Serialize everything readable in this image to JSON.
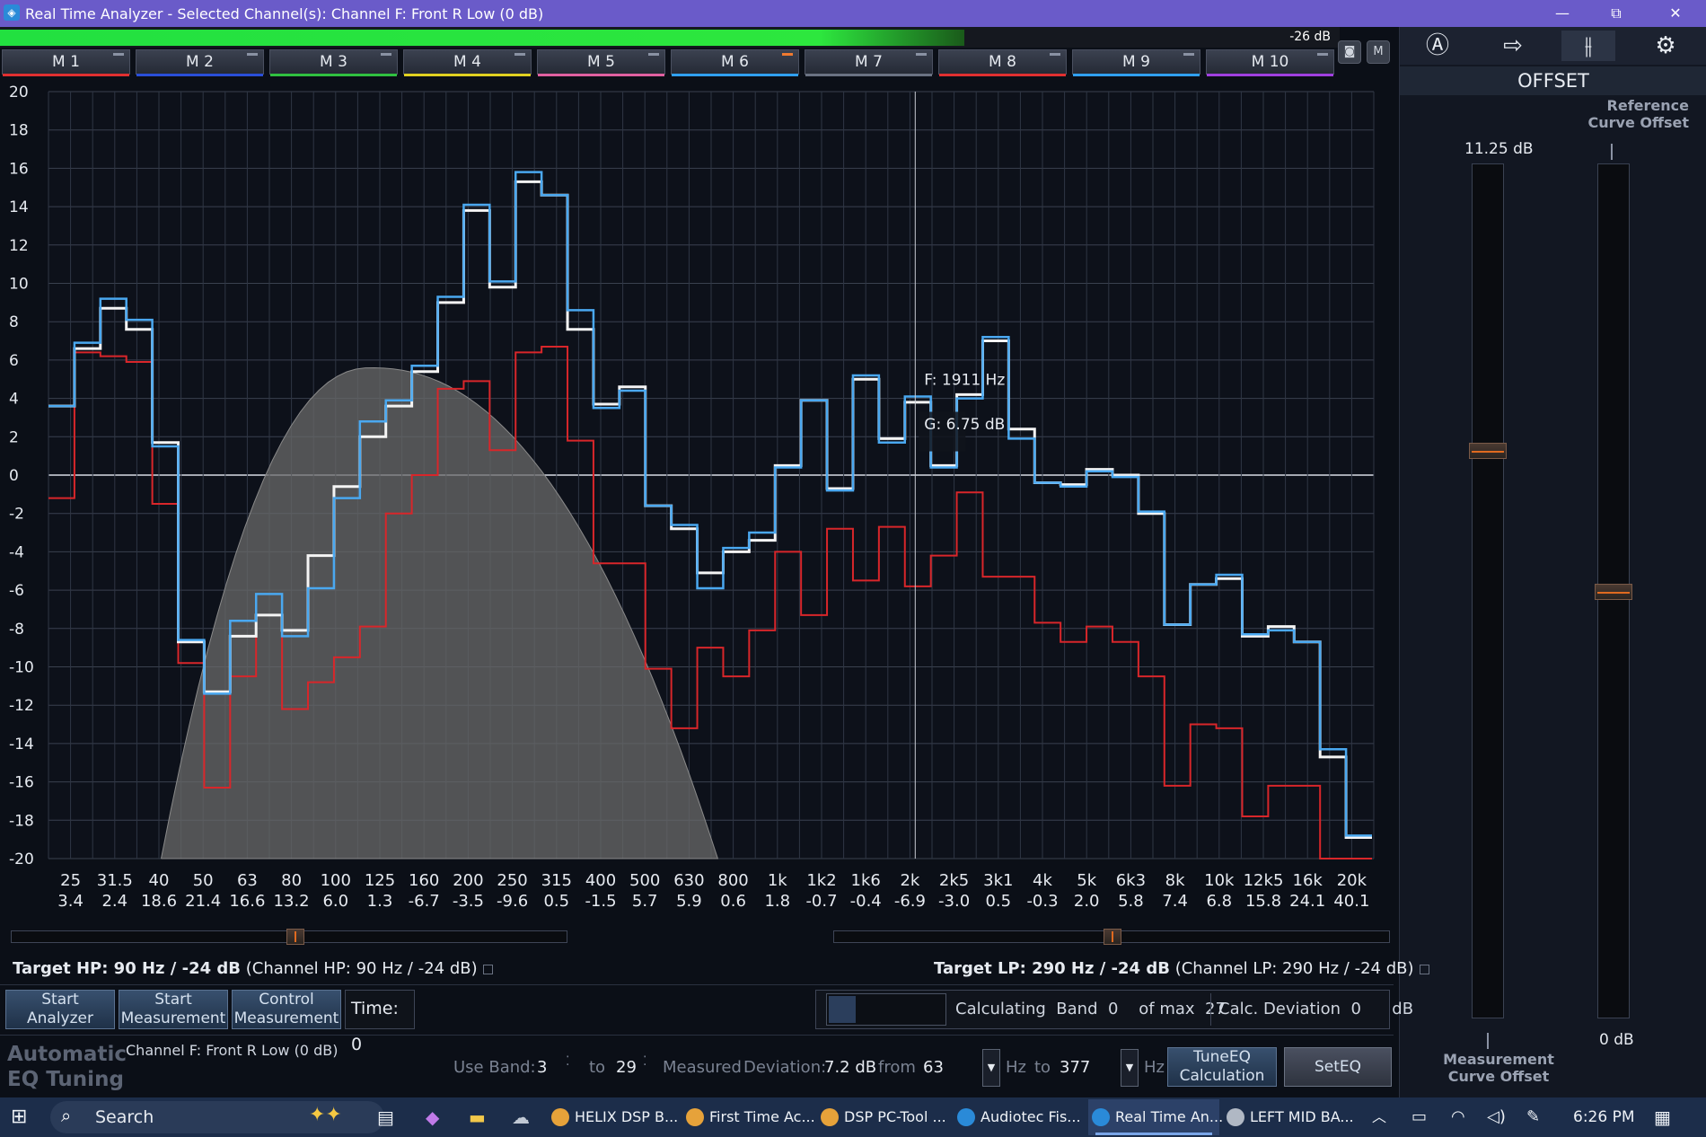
{
  "window": {
    "title": "Real Time Analyzer - Selected Channel(s): Channel F: Front R Low (0 dB)",
    "minimize": "—",
    "maximize": "⧉",
    "close": "✕"
  },
  "meter": {
    "level_label": "-26 dB",
    "level_fraction": 0.72
  },
  "memory_tabs": [
    {
      "label": "M 1",
      "color": "#e03030"
    },
    {
      "label": "M 2",
      "color": "#2a4fd8"
    },
    {
      "label": "M 3",
      "color": "#30c040"
    },
    {
      "label": "M 4",
      "color": "#e0d020"
    },
    {
      "label": "M 5",
      "color": "#e060a0"
    },
    {
      "label": "M 6",
      "color": "#30a0f0",
      "active": true
    },
    {
      "label": "M 7",
      "color": "#6a7282"
    },
    {
      "label": "M 8",
      "color": "#e03030"
    },
    {
      "label": "M 9",
      "color": "#30a0f0"
    },
    {
      "label": "M 10",
      "color": "#a040e0"
    }
  ],
  "right_panel": {
    "icons": [
      "auto-a-icon",
      "export-icon",
      "sliders-icon",
      "settings-gear-icon"
    ],
    "section": "OFFSET",
    "reference_label": "Reference\nCurve Offset",
    "measurement_value": "11.25 dB",
    "reference_value": "0 dB",
    "measurement_label": "Measurement\nCurve Offset",
    "left_slider_level_db": 11.25,
    "right_slider_level_db": 0
  },
  "chart_data": {
    "type": "line",
    "y_ticks": [
      20,
      18,
      16,
      14,
      12,
      10,
      8,
      6,
      4,
      2,
      0,
      -2,
      -4,
      -6,
      -8,
      -10,
      -12,
      -14,
      -16,
      -18,
      -20
    ],
    "ylim": [
      -20,
      20
    ],
    "x_ticks": [
      {
        "f": "25",
        "v": "3.4"
      },
      {
        "f": "31.5",
        "v": "2.4"
      },
      {
        "f": "40",
        "v": "18.6"
      },
      {
        "f": "50",
        "v": "21.4"
      },
      {
        "f": "63",
        "v": "16.6"
      },
      {
        "f": "80",
        "v": "13.2"
      },
      {
        "f": "100",
        "v": "6.0"
      },
      {
        "f": "125",
        "v": "1.3"
      },
      {
        "f": "160",
        "v": "-6.7"
      },
      {
        "f": "200",
        "v": "-3.5"
      },
      {
        "f": "250",
        "v": "-9.6"
      },
      {
        "f": "315",
        "v": "0.5"
      },
      {
        "f": "400",
        "v": "-1.5"
      },
      {
        "f": "500",
        "v": "5.7"
      },
      {
        "f": "630",
        "v": "5.9"
      },
      {
        "f": "800",
        "v": "0.6"
      },
      {
        "f": "1k",
        "v": "1.8"
      },
      {
        "f": "1k2",
        "v": "-0.7"
      },
      {
        "f": "1k6",
        "v": "-0.4"
      },
      {
        "f": "2k",
        "v": "-6.9"
      },
      {
        "f": "2k5",
        "v": "-3.0"
      },
      {
        "f": "3k1",
        "v": "0.5"
      },
      {
        "f": "4k",
        "v": "-0.3"
      },
      {
        "f": "5k",
        "v": "2.0"
      },
      {
        "f": "6k3",
        "v": "5.8"
      },
      {
        "f": "8k",
        "v": "7.4"
      },
      {
        "f": "10k",
        "v": "6.8"
      },
      {
        "f": "12k5",
        "v": "15.8"
      },
      {
        "f": "16k",
        "v": "24.1"
      },
      {
        "f": "20k",
        "v": "40.1"
      }
    ],
    "series": [
      {
        "name": "",
        "color": "#4aa8f0",
        "values": [
          3.6,
          6.9,
          9.2,
          8.1,
          1.5,
          -8.6,
          -11.4,
          -7.6,
          -6.2,
          -8.4,
          -5.9,
          -1.2,
          2.8,
          3.9,
          5.7,
          9.3,
          14.1,
          10.1,
          15.8,
          14.6,
          8.6,
          3.5,
          4.4,
          -1.6,
          -2.6,
          -5.9,
          -3.8,
          -3,
          0.4,
          3.9,
          -0.8,
          5.2,
          1.7,
          4.1,
          0.4,
          4,
          7.2,
          1.9,
          -0.4,
          -0.6,
          0.2,
          -0.1,
          -1.9,
          -7.8,
          -5.7,
          -5.2,
          -8.3,
          -8.1,
          -8.7,
          -14.3,
          -18.8
        ]
      },
      {
        "name": "",
        "color": "#f4f4f4",
        "values": [
          3.6,
          6.6,
          8.7,
          7.6,
          1.7,
          -8.7,
          -11.3,
          -8.4,
          -7.3,
          -8.1,
          -4.2,
          -0.6,
          2,
          3.6,
          5.4,
          9,
          13.8,
          9.8,
          15.3,
          14.6,
          7.6,
          3.7,
          4.6,
          -1.6,
          -2.8,
          -5.1,
          -4,
          -3.4,
          0.5,
          3.9,
          -0.7,
          5.0,
          1.9,
          3.8,
          0.5,
          4.2,
          7,
          2.4,
          -0.4,
          -0.5,
          0.3,
          0,
          -2,
          -7.8,
          -5.7,
          -5.4,
          -8.4,
          -7.9,
          -8.7,
          -14.7,
          -18.9
        ]
      },
      {
        "name": "",
        "color": "#d8262a",
        "values": [
          -1.2,
          6.4,
          6.2,
          5.9,
          -1.5,
          -9.8,
          -16.3,
          -10.5,
          -7.3,
          -12.2,
          -10.8,
          -9.5,
          -7.9,
          -2,
          0,
          4.5,
          4.9,
          1.3,
          6.4,
          6.7,
          1.8,
          -4.6,
          -4.6,
          -10.1,
          -13.2,
          -9,
          -10.5,
          -8.1,
          -4,
          -7.3,
          -2.8,
          -5.5,
          -2.7,
          -5.8,
          -4.2,
          -0.9,
          -5.3,
          -5.3,
          -7.7,
          -8.7,
          -7.9,
          -8.7,
          -10.5,
          -16.2,
          -13,
          -13.2,
          -17.8,
          -16.2,
          -16.2,
          -20,
          -20
        ]
      },
      {
        "name": "",
        "color": "#6a6a6a",
        "type": "area",
        "peak_db": 5.6,
        "range_left_db": -20,
        "range_right_db": -20
      }
    ],
    "cursor": {
      "freq_label": "F: 1911 Hz",
      "gain_label": "G: 6.75 dB"
    }
  },
  "sliders": {
    "left_position": 0.51,
    "right_position": 0.5
  },
  "targets": {
    "hp_bold": "Target HP: 90 Hz / -24 dB",
    "hp_channel": "(Channel HP: 90 Hz / -24 dB)",
    "lp_bold": "Target LP: 290 Hz / -24 dB",
    "lp_channel": "(Channel LP: 290 Hz / -24 dB)"
  },
  "controls": {
    "start_analyzer": "Start\nAnalyzer",
    "start_measurement": "Start\nMeasurement",
    "control_measurement": "Control\nMeasurement",
    "time": "Time: 0",
    "calculating": "Calculating",
    "band": "Band",
    "band_value": "0",
    "of_max": "of max",
    "of_max_value": "27",
    "calc_deviation": "Calc. Deviation",
    "calc_deviation_value": "0",
    "db_unit": "dB"
  },
  "auto_eq": {
    "title_line1": "Automatic",
    "title_line2": "EQ Tuning",
    "channel": "Channel F: Front R Low (0 dB)",
    "use_band": "Use Band:",
    "use_band_value": "3",
    "to": "to",
    "to_value": "29",
    "measured": "Measured",
    "deviation": "Deviation:",
    "deviation_value": "7.2 dB",
    "from": "from",
    "from_value": "63",
    "hz": "Hz",
    "hz_to": "to",
    "to_hz_value": "377",
    "tune_eq": "TuneEQ\nCalculation",
    "set_eq": "SetEQ"
  },
  "taskbar": {
    "search": "Search",
    "apps": [
      {
        "label": "HELIX DSP B...",
        "color": "#e6a23a"
      },
      {
        "label": "First Time Ac...",
        "color": "#e6a23a"
      },
      {
        "label": "DSP PC-Tool ...",
        "color": "#e6a23a"
      },
      {
        "label": "Audiotec Fis...",
        "color": "#2a8ad8"
      },
      {
        "label": "Real Time An...",
        "color": "#2a8ad8",
        "active": true
      },
      {
        "label": "LEFT MID BA...",
        "color": "#b0b8c4"
      }
    ],
    "time": "6:26 PM"
  }
}
